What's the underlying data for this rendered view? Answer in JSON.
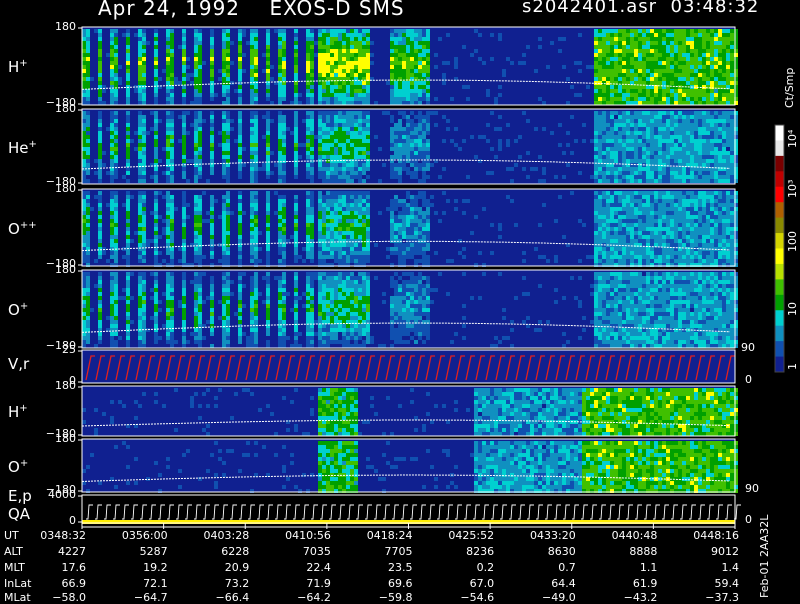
{
  "header": {
    "title": "Apr 24, 1992    EXOS-D SMS",
    "file": "s2042401.asr",
    "time": "03:48:32"
  },
  "colorbar": {
    "unit": "Ct/Smp",
    "ticks": [
      "10⁴",
      "10³",
      "100",
      "10",
      "1"
    ],
    "colors": [
      "#ffffff",
      "#e8e8e8",
      "#7a0000",
      "#c00000",
      "#ff0000",
      "#b06000",
      "#8a8a00",
      "#d4d400",
      "#ffff00",
      "#b8e000",
      "#40c000",
      "#00a000",
      "#00d0d0",
      "#1090c0",
      "#1050b0",
      "#102090"
    ]
  },
  "panels": [
    {
      "label": "H",
      "charge": "+",
      "ymax": "180",
      "ymin": "−180"
    },
    {
      "label": "He",
      "charge": "+",
      "ymax": "180",
      "ymin": "−180"
    },
    {
      "label": "O",
      "charge": "++",
      "ymax": "180",
      "ymin": "−180"
    },
    {
      "label": "O",
      "charge": "+",
      "ymax": "180",
      "ymin": "−180"
    },
    {
      "label": "V,r",
      "charge": "",
      "ymax": "25",
      "ymin": "0",
      "ymax_right": "90",
      "ymin_right": "0"
    },
    {
      "label": "H",
      "charge": "+",
      "ymax": "180",
      "ymin": "−180"
    },
    {
      "label": "O",
      "charge": "+",
      "ymax": "180",
      "ymin": "−180",
      "ymin_right": "90"
    },
    {
      "label": "E,p",
      "label2": "QA",
      "charge": "",
      "ymax": "4000",
      "ymin": "0",
      "ymin_right": "0"
    }
  ],
  "footer": {
    "rows": [
      {
        "name": "UT",
        "values": [
          "0348:32",
          "0356:00",
          "0403:28",
          "0410:56",
          "0418:24",
          "0425:52",
          "0433:20",
          "0440:48",
          "0448:16"
        ]
      },
      {
        "name": "ALT",
        "values": [
          "4227",
          "5287",
          "6228",
          "7035",
          "7705",
          "8236",
          "8630",
          "8888",
          "9012"
        ]
      },
      {
        "name": "MLT",
        "values": [
          "17.6",
          "19.2",
          "20.9",
          "22.4",
          "23.5",
          "0.2",
          "0.7",
          "1.1",
          "1.4"
        ]
      },
      {
        "name": "InLat",
        "values": [
          "66.9",
          "72.1",
          "73.2",
          "71.9",
          "69.6",
          "67.0",
          "64.4",
          "61.9",
          "59.4"
        ]
      },
      {
        "name": "MLat",
        "values": [
          "−58.0",
          "−64.7",
          "−66.4",
          "−64.2",
          "−59.8",
          "−54.6",
          "−49.0",
          "−43.2",
          "−37.3"
        ]
      }
    ],
    "side_note": "Feb-01 2AA32L"
  },
  "chart_data": {
    "type": "heatmap",
    "title": "Apr 24, 1992    EXOS-D SMS",
    "x_ticks": [
      "0348:32",
      "0356:00",
      "0403:28",
      "0410:56",
      "0418:24",
      "0425:52",
      "0433:20",
      "0440:48",
      "0448:16"
    ],
    "panels": [
      "H+",
      "He+",
      "O++",
      "O+",
      "V,r",
      "H+",
      "O+",
      "E,p QA"
    ],
    "colorbar_unit": "Ct/Smp",
    "colorbar_ticks": [
      "1",
      "10",
      "100",
      "10^3",
      "10^4"
    ]
  }
}
